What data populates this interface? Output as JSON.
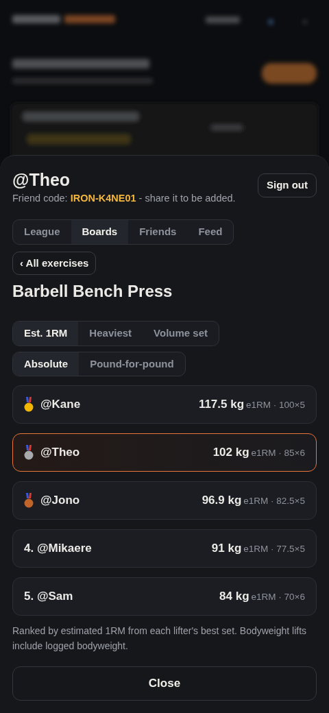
{
  "profile": {
    "handle": "@Theo",
    "friend_code_label": "Friend code:",
    "friend_code": "IRON-K4NE01",
    "friend_code_hint": "- share it to be added."
  },
  "sign_out": "Sign out",
  "tabs": [
    {
      "label": "League",
      "selected": false
    },
    {
      "label": "Boards",
      "selected": true
    },
    {
      "label": "Friends",
      "selected": false
    },
    {
      "label": "Feed",
      "selected": false
    }
  ],
  "back_link": "‹ All exercises",
  "exercise_title": "Barbell Bench Press",
  "metric_toggle": [
    {
      "label": "Est. 1RM",
      "selected": true
    },
    {
      "label": "Heaviest",
      "selected": false
    },
    {
      "label": "Volume set",
      "selected": false
    }
  ],
  "scale_toggle": [
    {
      "label": "Absolute",
      "selected": true
    },
    {
      "label": "Pound-for-pound",
      "selected": false
    }
  ],
  "leaderboard": [
    {
      "kind": "medal",
      "color": "#f2b705",
      "name": "@Kane",
      "value": "117.5 kg",
      "detail": "e1RM · 100×5",
      "selected": false
    },
    {
      "kind": "medal",
      "color": "#a7a9ad",
      "name": "@Theo",
      "value": "102 kg",
      "detail": "e1RM · 85×6",
      "selected": true
    },
    {
      "kind": "medal",
      "color": "#c0642a",
      "name": "@Jono",
      "value": "96.9 kg",
      "detail": "e1RM · 82.5×5",
      "selected": false
    },
    {
      "kind": "rank",
      "rank": "4.",
      "name": "@Mikaere",
      "value": "91 kg",
      "detail": "e1RM · 77.5×5",
      "selected": false
    },
    {
      "kind": "rank",
      "rank": "5.",
      "name": "@Sam",
      "value": "84 kg",
      "detail": "e1RM · 70×6",
      "selected": false
    }
  ],
  "footnote": "Ranked by estimated 1RM from each lifter's best set. Bodyweight lifts include logged bodyweight.",
  "close": "Close"
}
